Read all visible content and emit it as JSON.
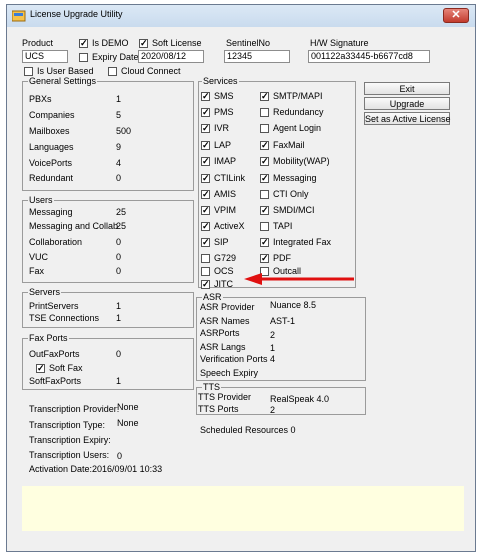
{
  "window": {
    "title": "License Upgrade Utility",
    "close_glyph": "✕"
  },
  "product": {
    "label": "Product",
    "value": "UCS"
  },
  "is_demo": {
    "label": "Is DEMO",
    "checked": true
  },
  "soft_license": {
    "label": "Soft License",
    "checked": true
  },
  "expiry": {
    "label": "Expiry Date",
    "checked": false,
    "value": "2020/08/12"
  },
  "sentinel": {
    "label": "SentinelNo",
    "value": "12345"
  },
  "hw_signature": {
    "label": "H/W Signature",
    "value": "001122a33445-b6677cd8"
  },
  "is_user_based": {
    "label": "Is User Based",
    "checked": false
  },
  "cloud_connect": {
    "label": "Cloud Connect",
    "checked": false
  },
  "general": {
    "legend": "General Settings",
    "rows": [
      {
        "label": "PBXs",
        "value": "1"
      },
      {
        "label": "Companies",
        "value": "5"
      },
      {
        "label": "Mailboxes",
        "value": "500"
      },
      {
        "label": "Languages",
        "value": "9"
      },
      {
        "label": "VoicePorts",
        "value": "4"
      },
      {
        "label": "Redundant",
        "value": "0"
      }
    ]
  },
  "users": {
    "legend": "Users",
    "rows": [
      {
        "label": "Messaging",
        "value": "25"
      },
      {
        "label": "Messaging and Collab",
        "value": "25"
      },
      {
        "label": "Collaboration",
        "value": "0"
      },
      {
        "label": "VUC",
        "value": "0"
      },
      {
        "label": "Fax",
        "value": "0"
      }
    ]
  },
  "servers": {
    "legend": "Servers",
    "rows": [
      {
        "label": "PrintServers",
        "value": "1"
      },
      {
        "label": "TSE Connections",
        "value": "1"
      }
    ]
  },
  "fax_ports": {
    "legend": "Fax Ports",
    "out_label": "OutFaxPorts",
    "out_value": "0",
    "soft_fax_label": "Soft Fax",
    "soft_fax_checked": true,
    "soft_ports_label": "SoftFaxPorts",
    "soft_ports_value": "1"
  },
  "transcription": {
    "provider_label": "Transcription Provider:",
    "provider_value": "None",
    "type_label": "Transcription Type:",
    "type_value": "None",
    "expiry_label": "Transcription Expiry:",
    "users_label": "Transcription Users:",
    "users_value": "0",
    "activation": "Activation Date:2016/09/01 10:33"
  },
  "services": {
    "legend": "Services",
    "left": [
      {
        "label": "SMS",
        "checked": true
      },
      {
        "label": "PMS",
        "checked": true
      },
      {
        "label": "IVR",
        "checked": true
      },
      {
        "label": "LAP",
        "checked": true
      },
      {
        "label": "IMAP",
        "checked": true
      },
      {
        "label": "CTILink",
        "checked": true
      },
      {
        "label": "AMIS",
        "checked": true
      },
      {
        "label": "VPIM",
        "checked": true
      },
      {
        "label": "ActiveX",
        "checked": true
      },
      {
        "label": "SIP",
        "checked": true
      },
      {
        "label": "G729",
        "checked": false
      },
      {
        "label": "OCS",
        "checked": false
      },
      {
        "label": "JITC",
        "checked": true
      }
    ],
    "right": [
      {
        "label": "SMTP/MAPI",
        "checked": true
      },
      {
        "label": "Redundancy",
        "checked": false
      },
      {
        "label": "Agent Login",
        "checked": false
      },
      {
        "label": "FaxMail",
        "checked": true
      },
      {
        "label": "Mobility(WAP)",
        "checked": true
      },
      {
        "label": "Messaging",
        "checked": true
      },
      {
        "label": "CTI Only",
        "checked": false
      },
      {
        "label": "SMDI/MCI",
        "checked": true
      },
      {
        "label": "TAPI",
        "checked": false
      },
      {
        "label": "Integrated Fax",
        "checked": true
      },
      {
        "label": "PDF",
        "checked": true
      },
      {
        "label": "Outcall",
        "checked": false
      }
    ]
  },
  "asr": {
    "legend": "ASR",
    "rows": [
      {
        "label": "ASR Provider",
        "value": "Nuance 8.5"
      },
      {
        "label": "ASR Names",
        "value": "AST-1"
      },
      {
        "label": "ASRPorts",
        "value": "2"
      },
      {
        "label": "ASR Langs",
        "value": "1"
      },
      {
        "label": "Verification Ports",
        "value": "4"
      },
      {
        "label": "Speech Expiry",
        "value": ""
      }
    ]
  },
  "tts": {
    "legend": "TTS",
    "rows": [
      {
        "label": "TTS Provider",
        "value": "RealSpeak 4.0"
      },
      {
        "label": "TTS Ports",
        "value": "2"
      }
    ]
  },
  "scheduled": "Scheduled Resources  0",
  "buttons": {
    "exit": "Exit",
    "upgrade": "Upgrade",
    "set_active": "Set as Active License"
  },
  "colors": {
    "arrow": "#e01010",
    "bottom_panel": "#ffffe0",
    "title_bar": "#c9dbee"
  }
}
